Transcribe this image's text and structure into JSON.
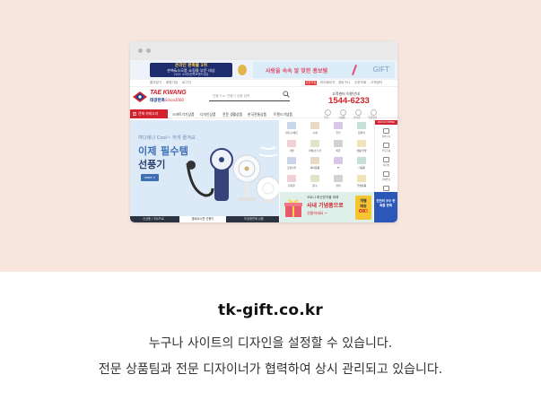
{
  "site": {
    "award": {
      "line1": "온라인 판촉물 1위",
      "line2": "판촉&소모품 쇼핑몰 부문 대상",
      "line3": "2021 소비자만족브랜드대상"
    },
    "promo": {
      "text": "사랑을 속속 알 맞한 홍보템",
      "gift_logo": "GIFT"
    },
    "util_left": [
      "즐겨찾기",
      "회원가입",
      "로그인"
    ],
    "util_tag": "신규가입 혜택",
    "util_right": [
      "마이페이지",
      "장바구니",
      "주문조회",
      "고객센터"
    ],
    "logo": {
      "name": "TAE KWANG",
      "korean": "태광판촉",
      "since": "Since2000"
    },
    "search": {
      "placeholder": "선풍기 or 선풍기 상품 입력"
    },
    "cs": {
      "label": "고객센터 이용안내",
      "phone": "1544-6233"
    },
    "nav": {
      "category_label": "전체 카테고리",
      "items": [
        "스마트기기상품",
        "디자인상품",
        "전문 생활상품",
        "한국전통상품",
        "트렌드기념품"
      ],
      "mini": [
        "우산",
        "기념품",
        "판촉물",
        "주문제작"
      ]
    },
    "banner": {
      "sub": "여디에나 Cool~ 하게 즐겨요",
      "headline": "이제 필수템",
      "product": "선풍기",
      "button": "more >",
      "tabs": [
        "신상품 / 히트프로",
        "올바르시면 선풍기",
        "미정품판매 상품"
      ]
    },
    "categories": [
      "필기구/세트",
      "시계",
      "우산",
      "텀블러",
      "가방",
      "타월/손수건",
      "의류",
      "생활/주방",
      "소형가전",
      "육아용품",
      "IT",
      "기념품",
      "판촉물",
      "문구",
      "뷰티",
      "주방용품"
    ],
    "side": {
      "head": "QUICK MENU",
      "items": [
        "장바구니",
        "주문조회",
        "자료실",
        "단체주문",
        "빠른견적"
      ],
      "foot": "TOP"
    },
    "promo_a": {
      "line1": "코로나 확산방지를 위해",
      "line2": "사내 기념품으로",
      "line3": "선물하세요 ~",
      "badge_1": "개별",
      "badge_2": "배송",
      "badge_3": "OK!"
    },
    "promo_b": {
      "text": "인연의 우수 판촉물 판매"
    }
  },
  "footer": {
    "domain": "tk-gift.co.kr",
    "line1": "누구나 사이트의 디자인을 설정할 수 있습니다.",
    "line2": "전문 상품팀과 전문 디자이너가 협력하여 상시 관리되고 있습니다."
  },
  "colors": {
    "hero_bg": "#f6e6de",
    "brand_red": "#d2222d",
    "brand_blue": "#1b3f8f",
    "banner_bg": "#dce9f6"
  }
}
